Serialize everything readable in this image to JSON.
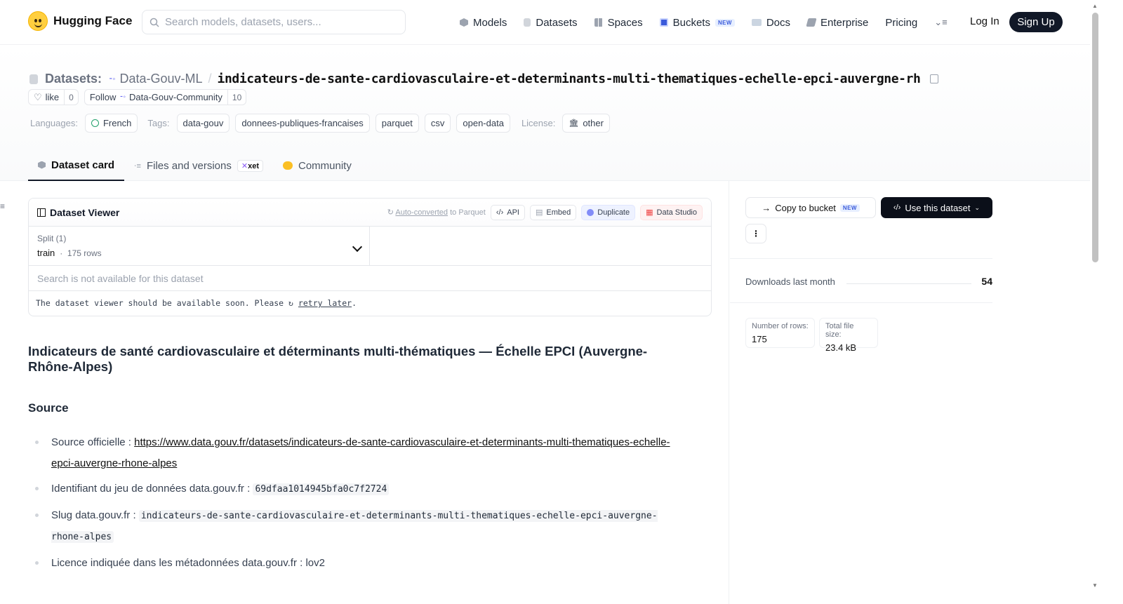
{
  "header": {
    "brand": "Hugging Face",
    "search_placeholder": "Search models, datasets, users...",
    "nav": [
      {
        "label": "Models",
        "icon": "cube-icon"
      },
      {
        "label": "Datasets",
        "icon": "database-icon"
      },
      {
        "label": "Spaces",
        "icon": "grid-icon"
      },
      {
        "label": "Buckets",
        "icon": "bucket-icon",
        "badge": "NEW"
      },
      {
        "label": "Docs",
        "icon": "book-icon"
      },
      {
        "label": "Enterprise",
        "icon": "enterprise-icon"
      },
      {
        "label": "Pricing"
      }
    ],
    "login": "Log In",
    "signup": "Sign Up"
  },
  "repo": {
    "type_label": "Datasets:",
    "org": "Data-Gouv-ML",
    "name": "indicateurs-de-sante-cardiovasculaire-et-determinants-multi-thematiques-echelle-epci-auvergne-rh",
    "like_label": "like",
    "like_count": "0",
    "follow_label": "Follow",
    "follow_org": "Data-Gouv-Community",
    "follow_count": "10",
    "languages_label": "Languages:",
    "language": "French",
    "tags_label": "Tags:",
    "tags": [
      "data-gouv",
      "donnees-publiques-francaises",
      "parquet",
      "csv",
      "open-data"
    ],
    "license_label": "License:",
    "license": "other"
  },
  "tabs": [
    {
      "label": "Dataset card",
      "active": true
    },
    {
      "label": "Files and versions",
      "badge": "xet"
    },
    {
      "label": "Community"
    }
  ],
  "viewer": {
    "title": "Dataset Viewer",
    "autoconv": "Auto-converted",
    "autoconv_suffix": " to Parquet",
    "api": "API",
    "embed": "Embed",
    "duplicate": "Duplicate",
    "studio": "Data Studio",
    "split_label": "Split (1)",
    "split_name": "train",
    "split_rows": "175 rows",
    "search_placeholder": "Search is not available for this dataset",
    "message": "The dataset viewer should be available soon. Please",
    "retry": "retry later",
    "message_end": "."
  },
  "readme": {
    "title": "Indicateurs de santé cardiovasculaire et déterminants multi-thématiques — Échelle EPCI (Auvergne-Rhône-Alpes)",
    "source_heading": "Source",
    "source_prefix": "Source officielle : ",
    "source_url": "https://www.data.gouv.fr/datasets/indicateurs-de-sante-cardiovasculaire-et-determinants-multi-thematiques-echelle-epci-auvergne-rhone-alpes",
    "id_prefix": "Identifiant du jeu de données data.gouv.fr : ",
    "id_value": "69dfaa1014945bfa0c7f2724",
    "slug_prefix": "Slug data.gouv.fr : ",
    "slug_value": "indicateurs-de-sante-cardiovasculaire-et-determinants-multi-thematiques-echelle-epci-auvergne-rhone-alpes",
    "licence_line": "Licence indiquée dans les métadonnées data.gouv.fr : lov2"
  },
  "sidebar": {
    "copy_bucket": "Copy to bucket",
    "copy_badge": "NEW",
    "use_dataset": "Use this dataset",
    "downloads_label": "Downloads last month",
    "downloads_value": "54",
    "rows_label": "Number of rows:",
    "rows_value": "175",
    "size_label": "Total file size:",
    "size_value": "23.4 kB"
  },
  "colors": {
    "primary_dark": "#111827",
    "new_badge": "#3b5bdb",
    "logo_yellow": "#ffcf3f"
  }
}
